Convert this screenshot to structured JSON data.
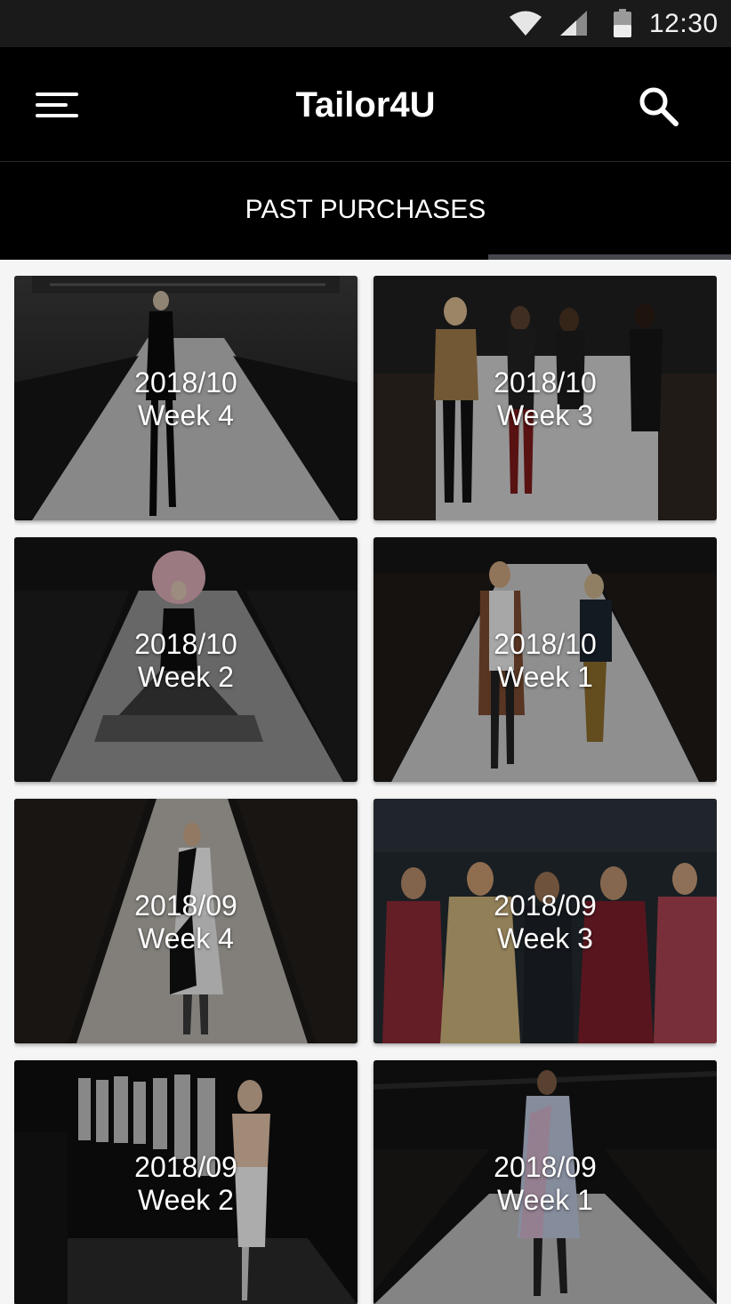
{
  "status_bar": {
    "time": "12:30",
    "icons": [
      "wifi-icon",
      "cell-signal-icon",
      "battery-icon"
    ]
  },
  "app_bar": {
    "title": "Tailor4U",
    "menu_icon": "menu-icon",
    "search_icon": "search-icon"
  },
  "tabs": [
    {
      "label": "PAST PURCHASES",
      "selected": true
    }
  ],
  "colors": {
    "app_bar": "#000000",
    "status_bar": "#1a1a1a",
    "tab_indicator": "#45474d",
    "background": "#f5f5f5"
  },
  "cards": [
    {
      "month": "2018/10",
      "week": "Week 4"
    },
    {
      "month": "2018/10",
      "week": "Week 3"
    },
    {
      "month": "2018/10",
      "week": "Week 2"
    },
    {
      "month": "2018/10",
      "week": "Week 1"
    },
    {
      "month": "2018/09",
      "week": "Week 4"
    },
    {
      "month": "2018/09",
      "week": "Week 3"
    },
    {
      "month": "2018/09",
      "week": "Week 2"
    },
    {
      "month": "2018/09",
      "week": "Week 1"
    }
  ]
}
